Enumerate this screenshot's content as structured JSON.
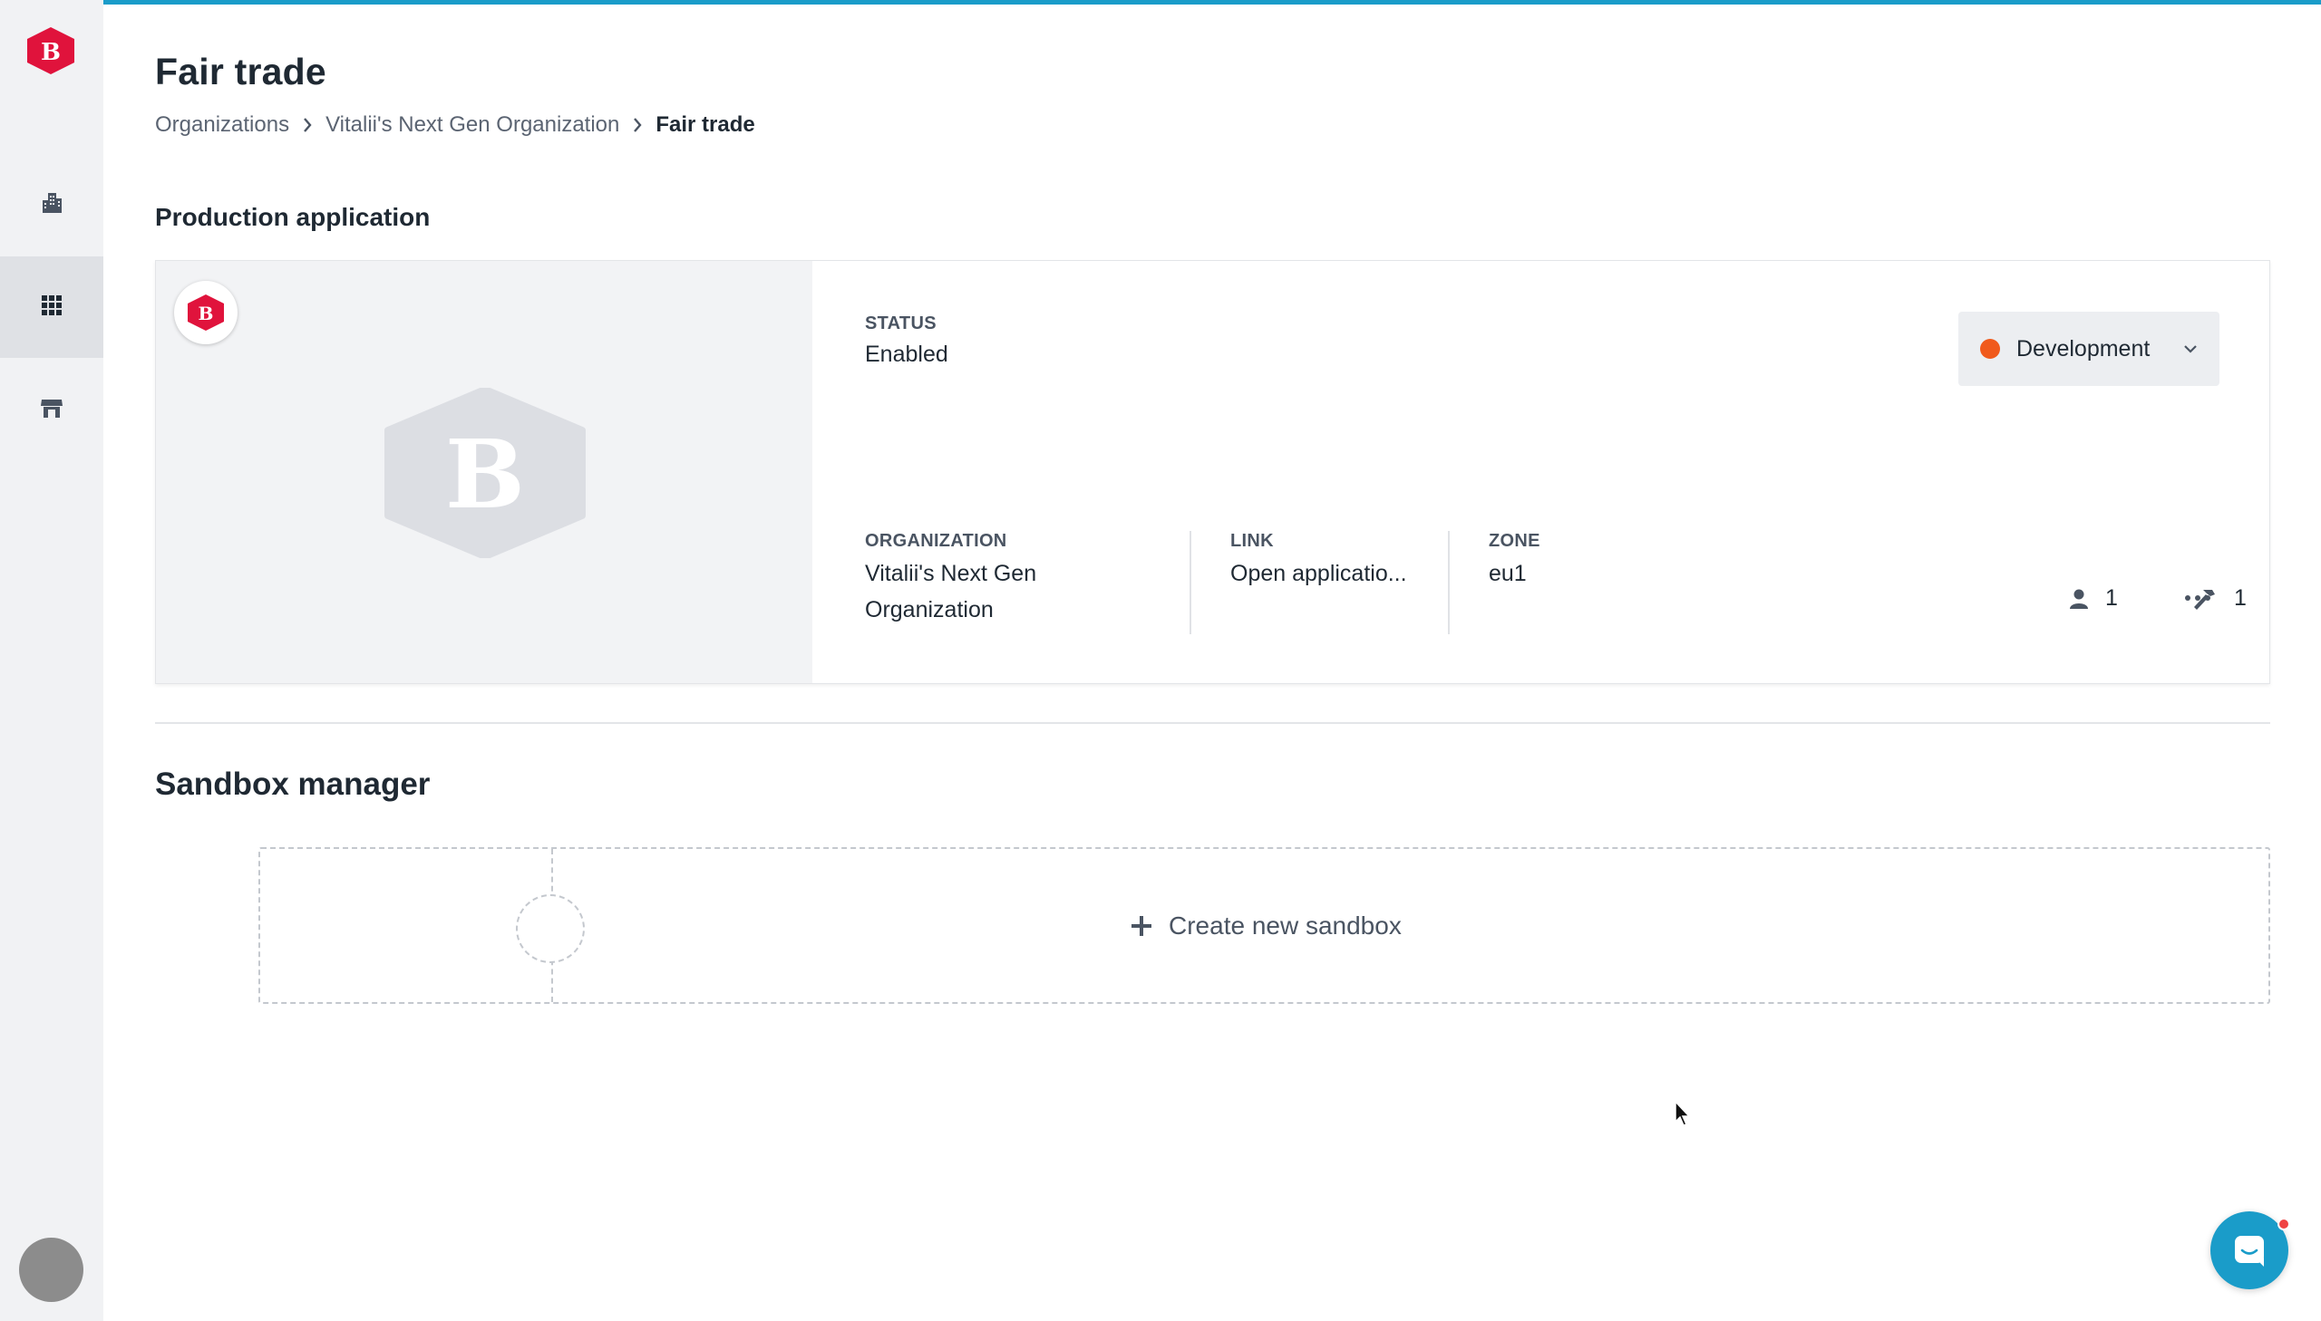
{
  "app": {
    "logo_letter": "B",
    "brand_color": "#e0133c",
    "accent_color": "#1a9cc9"
  },
  "sidebar": {
    "items": [
      {
        "icon": "building-icon",
        "label": "Organizations",
        "active": false
      },
      {
        "icon": "apps-grid-icon",
        "label": "Applications",
        "active": true
      },
      {
        "icon": "store-icon",
        "label": "Marketplace",
        "active": false
      }
    ]
  },
  "page": {
    "title": "Fair trade",
    "breadcrumb": [
      "Organizations",
      "Vitalii's Next Gen Organization",
      "Fair trade"
    ]
  },
  "production": {
    "section_title": "Production application",
    "status_label": "STATUS",
    "status_value": "Enabled",
    "environment": "Development",
    "environment_color": "#f05a1c",
    "organization_label": "ORGANIZATION",
    "organization_value_line1": "Vitalii's Next Gen",
    "organization_value_line2": "Organization",
    "link_label": "LINK",
    "link_value": "Open applicatio...",
    "zone_label": "ZONE",
    "zone_value": "eu1",
    "members_count": "1",
    "developers_count": "1",
    "more_label": "···"
  },
  "sandbox": {
    "title": "Sandbox manager",
    "create_label": "Create new sandbox"
  }
}
